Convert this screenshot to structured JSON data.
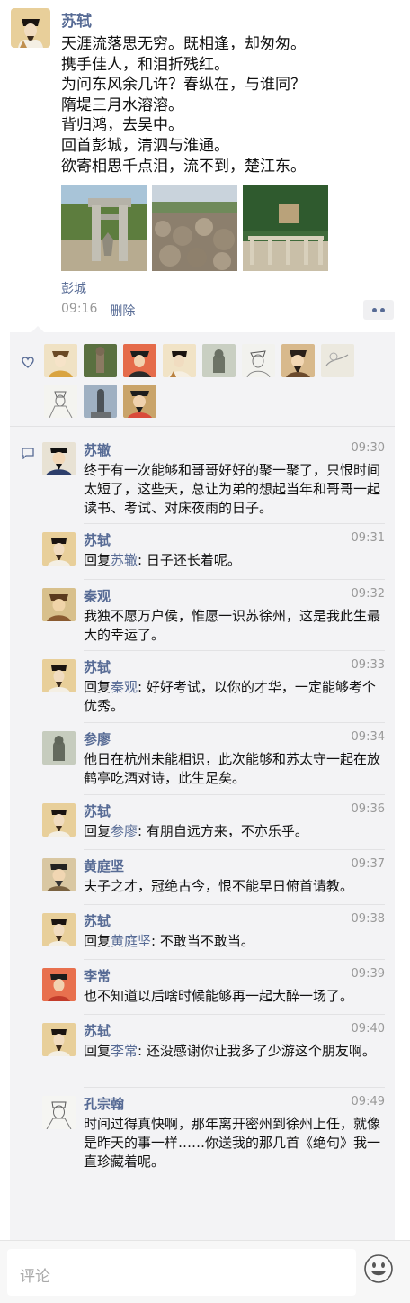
{
  "post": {
    "author": "苏轼",
    "text": "天涯流落思无穷。既相逢，却匆匆。\n携手佳人，和泪折残红。\n为问东风余几许？春纵在，与谁同？\n隋堤三月水溶溶。\n背归鸿，去吴中。\n回首彭城，清泗与淮通。\n欲寄相思千点泪，流不到，楚江东。",
    "location": "彭城",
    "time": "09:16",
    "delete_label": "删除"
  },
  "likes": {
    "count": 11
  },
  "comments": [
    {
      "name": "苏辙",
      "time": "09:30",
      "reply_to": "",
      "text": "终于有一次能够和哥哥好好的聚一聚了，只恨时间太短了，这些天，总让为弟的想起当年和哥哥一起读书、考试、对床夜雨的日子。"
    },
    {
      "name": "苏轼",
      "time": "09:31",
      "reply_prefix": "回复",
      "reply_to": "苏辙",
      "text": ": 日子还长着呢。"
    },
    {
      "name": "秦观",
      "time": "09:32",
      "reply_to": "",
      "text": "我独不愿万户侯，惟愿一识苏徐州，这是我此生最大的幸运了。"
    },
    {
      "name": "苏轼",
      "time": "09:33",
      "reply_prefix": "回复",
      "reply_to": "秦观",
      "text": ": 好好考试，以你的才华，一定能够考个优秀。"
    },
    {
      "name": "参廖",
      "time": "09:34",
      "reply_to": "",
      "text": "他日在杭州未能相识，此次能够和苏太守一起在放鹤亭吃酒对诗，此生足矣。"
    },
    {
      "name": "苏轼",
      "time": "09:36",
      "reply_prefix": "回复",
      "reply_to": "参廖",
      "text": ": 有朋自远方来，不亦乐乎。"
    },
    {
      "name": "黄庭坚",
      "time": "09:37",
      "reply_to": "",
      "text": "夫子之才，冠绝古今，恨不能早日俯首请教。"
    },
    {
      "name": "苏轼",
      "time": "09:38",
      "reply_prefix": "回复",
      "reply_to": "黄庭坚",
      "text": ": 不敢当不敢当。"
    },
    {
      "name": "李常",
      "time": "09:39",
      "reply_to": "",
      "text": "也不知道以后啥时候能够再一起大醉一场了。"
    },
    {
      "name": "苏轼",
      "time": "09:40",
      "reply_prefix": "回复",
      "reply_to": "李常",
      "text": ": 还没感谢你让我多了少游这个朋友啊。"
    },
    {
      "name": "孔宗翰",
      "time": "09:49",
      "reply_to": "",
      "text": "时间过得真快啊，那年离开密州到徐州上任，就像是昨天的事一样……你送我的那几首《绝句》我一直珍藏着呢。"
    }
  ],
  "input": {
    "placeholder": "评论"
  },
  "colors": {
    "link": "#576b95",
    "panel": "#f3f3f5",
    "meta": "#999999"
  },
  "icons": [
    "heart-icon",
    "comment-icon",
    "more-dots-icon",
    "emoji-icon"
  ]
}
